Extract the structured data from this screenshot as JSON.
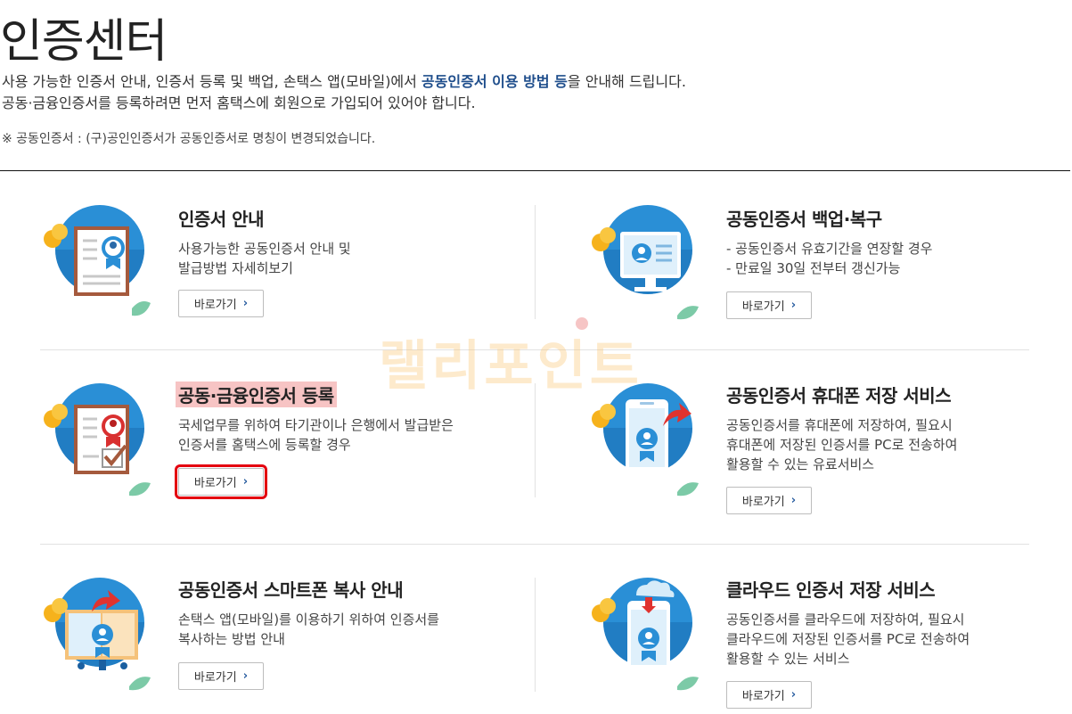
{
  "page": {
    "title": "인증센터",
    "intro_line1_a": "사용 가능한 인증서 안내, 인증서 등록 및 백업, 손택스 앱(모바일)에서 ",
    "intro_line1_hl": "공동인증서 이용 방법 등",
    "intro_line1_b": "을 안내해 드립니다.",
    "intro_line2": "공동·금융인증서를 등록하려면 먼저 홈택스에 회원으로 가입되어 있어야 합니다.",
    "note": "※ 공동인증서 : (구)공인인증서가 공동인증서로 명칭이 변경되었습니다."
  },
  "watermark": "랠리포인트",
  "button_label": "바로가기",
  "button_arrow": "›",
  "cards": [
    {
      "title": "인증서 안내",
      "desc": [
        "사용가능한 공동인증서 안내 및",
        "발급방법 자세히보기"
      ],
      "icon": "certificate-document-icon"
    },
    {
      "title": "공동인증서 백업·복구",
      "desc": [
        "- 공동인증서 유효기간을 연장할 경우",
        "- 만료일 30일 전부터 갱신가능"
      ],
      "icon": "monitor-certificate-icon"
    },
    {
      "title": "공동·금융인증서 등록",
      "desc": [
        "국세업무를 위하여 타기관이나 은행에서 발급받은",
        "인증서를 홈택스에 등록할 경우"
      ],
      "icon": "certificate-check-icon"
    },
    {
      "title": "공동인증서 휴대폰 저장 서비스",
      "desc": [
        "공동인증서를 휴대폰에 저장하여, 필요시",
        "휴대폰에 저장된 인증서를 PC로 전송하여",
        "활용할 수 있는 유료서비스"
      ],
      "icon": "phone-certificate-icon"
    },
    {
      "title": "공동인증서 스마트폰 복사 안내",
      "desc": [
        "손택스 앱(모바일)를 이용하기 위하여 인증서를",
        "복사하는 방법 안내"
      ],
      "icon": "certificate-copy-icon"
    },
    {
      "title": "클라우드 인증서 저장 서비스",
      "desc": [
        "공동인증서를 클라우드에 저장하여, 필요시",
        "클라우드에 저장된 인증서를 PC로 전송하여",
        "활용할 수 있는 서비스"
      ],
      "icon": "cloud-certificate-icon"
    }
  ]
}
